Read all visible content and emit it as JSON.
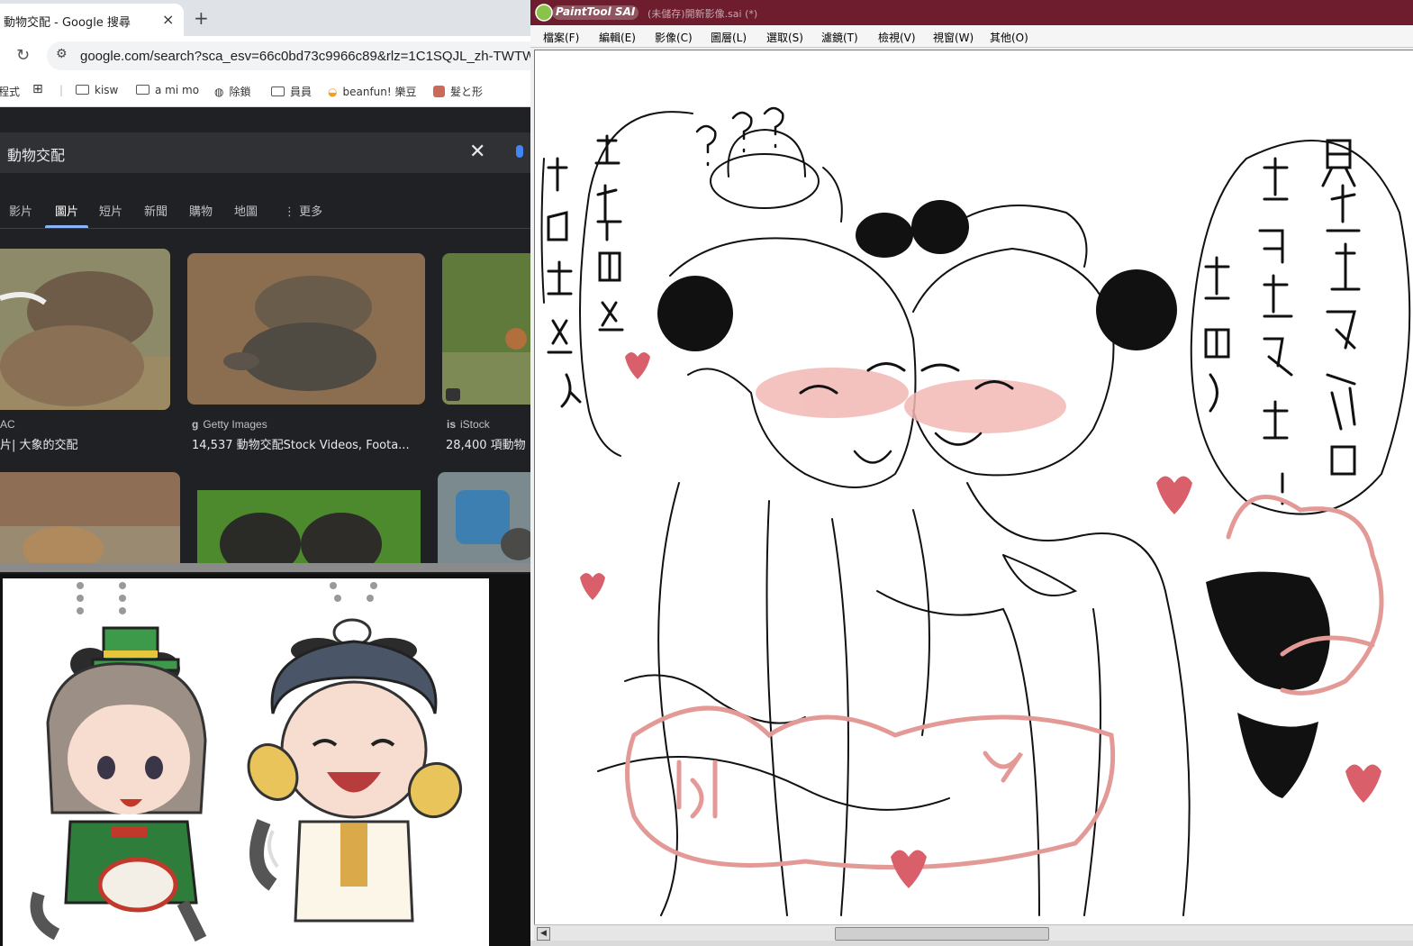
{
  "browser": {
    "tab_title": "動物交配 - Google 搜尋",
    "tab_close": "×",
    "new_tab": "+",
    "reload": "↻",
    "url": "google.com/search?sca_esv=66c0bd73c9966c89&rlz=1C1SQJL_zh-TWTW...",
    "bookmarks": [
      {
        "label": "程式",
        "icon": "apps-icon"
      },
      {
        "label": "kisw",
        "icon": "folder-icon"
      },
      {
        "label": "a mi mo",
        "icon": "folder-icon"
      },
      {
        "label": "除鎖",
        "icon": "globe-icon"
      },
      {
        "label": "員員",
        "icon": "folder-icon"
      },
      {
        "label": "beanfun! 樂豆",
        "icon": "beanfun-icon"
      },
      {
        "label": "髮と形",
        "icon": "bookmark-favicon"
      }
    ],
    "search": {
      "query": "動物交配",
      "clear": "✕"
    },
    "tabs": [
      "影片",
      "圖片",
      "短片",
      "新聞",
      "購物",
      "地圖",
      "⋮ 更多"
    ],
    "active_tab": "圖片",
    "results": [
      {
        "source": "AC",
        "caption": "片| 大象的交配"
      },
      {
        "source": "Getty Images",
        "caption": "14,537 動物交配Stock Videos, Foota..."
      },
      {
        "source": "iStock",
        "caption": "28,400 項動物"
      }
    ]
  },
  "sai": {
    "app_name": "PaintTool SAI",
    "document_title": "(未儲存)開新影像.sai (*)",
    "menus": [
      "檔案(F)",
      "編輯(E)",
      "影像(C)",
      "圖層(L)",
      "選取(S)",
      "濾鏡(T)",
      "檢視(V)",
      "視窗(W)",
      "其他(O)"
    ],
    "scroll_left": "◀"
  },
  "colors": {
    "sai_titlebar": "#6d1d2d",
    "google_accent": "#8ab4f8",
    "dark_page": "#202124",
    "sketch_pink": "#e8a0a0"
  }
}
